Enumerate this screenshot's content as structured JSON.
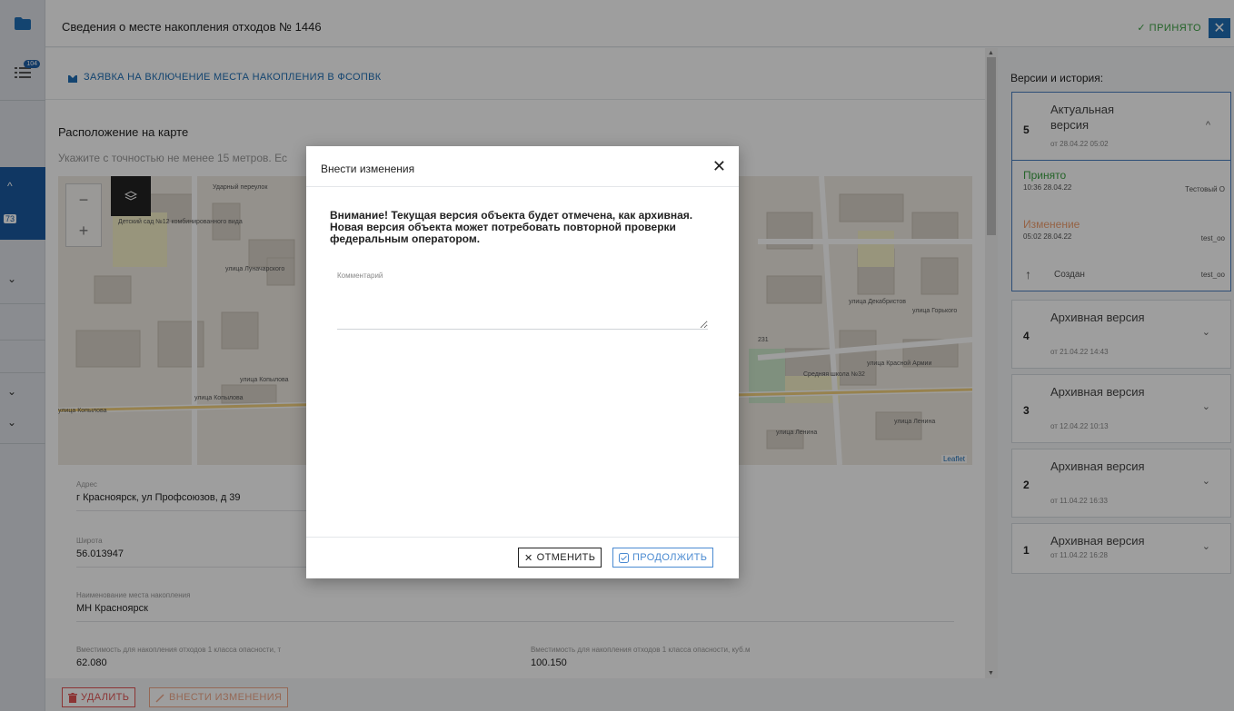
{
  "header": {
    "title": "Сведения о месте накопления отходов № 1446",
    "status": "✓ ПРИНЯТО",
    "close_symbol": "✕"
  },
  "rail": {
    "list_badge": "104",
    "count_badge": "73"
  },
  "main": {
    "request_link": "ЗАЯВКА НА ВКЛЮЧЕНИЕ МЕСТА НАКОПЛЕНИЯ В ФСОПВК",
    "map_title": "Расположение на карте",
    "map_hint": "Укажите с точностью не менее 15 метров. Ес",
    "map_attribution": "Leaflet",
    "map_labels": {
      "kindergarten": "Детский сад №12 комбинированного вида",
      "school": "Средняя школа №32",
      "street_udarny": "Ударный переулок",
      "street_lunacharskogo": "улица Луначарского",
      "street_kopylova1": "улица Копылова",
      "street_kopylova2": "улица Копылова",
      "street_kopylova3": "улица Копылова",
      "street_krasnoy_armii": "улица Красной Армии",
      "street_lenina1": "улица Ленина",
      "street_lenina2": "улица Ленина",
      "street_gorkogo": "улица Горького",
      "street_dekabristov": "улица Декабристов",
      "house_231": "231"
    },
    "fields": {
      "address_label": "Адрес",
      "address_value": "г Красноярск, ул Профсоюзов, д 39",
      "lat_label": "Широта",
      "lat_value": "56.013947",
      "name_label": "Наименование места накопления",
      "name_value": "МН Красноярск",
      "cap_t_label": "Вместимость для накопления отходов 1 класса опасности, т",
      "cap_t_value": "62.080",
      "cap_m3_label": "Вместимость для накопления отходов 1 класса опасности, куб.м",
      "cap_m3_value": "100.150"
    }
  },
  "bottombar": {
    "delete_label": "УДАЛИТЬ",
    "edit_label": "ВНЕСТИ ИЗМЕНЕНИЯ"
  },
  "right": {
    "title": "Версии и история:",
    "versions": [
      {
        "num": "5",
        "name": "Актуальная версия",
        "date": "от 28.04.22 05:02"
      },
      {
        "num": "4",
        "name": "Архивная версия",
        "date": "от 21.04.22 14:43"
      },
      {
        "num": "3",
        "name": "Архивная версия",
        "date": "от 12.04.22 10:13"
      },
      {
        "num": "2",
        "name": "Архивная версия",
        "date": "от 11.04.22 16:33"
      },
      {
        "num": "1",
        "name": "Архивная версия",
        "date": "от 11.04.22 16:28"
      }
    ],
    "history": [
      {
        "status": "Принято",
        "time": "10:36 28.04.22",
        "user": "Тестовый О",
        "color": "#3aa142"
      },
      {
        "status": "Изменение",
        "time": "05:02 28.04.22",
        "user": "test_oo",
        "color": "#f0a070"
      },
      {
        "status": "Создан",
        "time": "",
        "user": "test_oo",
        "color": "#555555"
      }
    ]
  },
  "modal": {
    "title": "Внести изменения",
    "warning": "Внимание! Текущая версия объекта будет отмечена, как архивная. Новая версия объекта может потребовать повторной проверки федеральным оператором.",
    "comment_label": "Комментарий",
    "comment_value": "",
    "cancel_label": "ОТМЕНИТЬ",
    "continue_label": "ПРОДОЛЖИТЬ"
  },
  "colors": {
    "accent_blue": "#1f6fb5",
    "accepted_green": "#3aa142",
    "delete_red": "#e25454",
    "edit_orange": "#f0a88a"
  }
}
